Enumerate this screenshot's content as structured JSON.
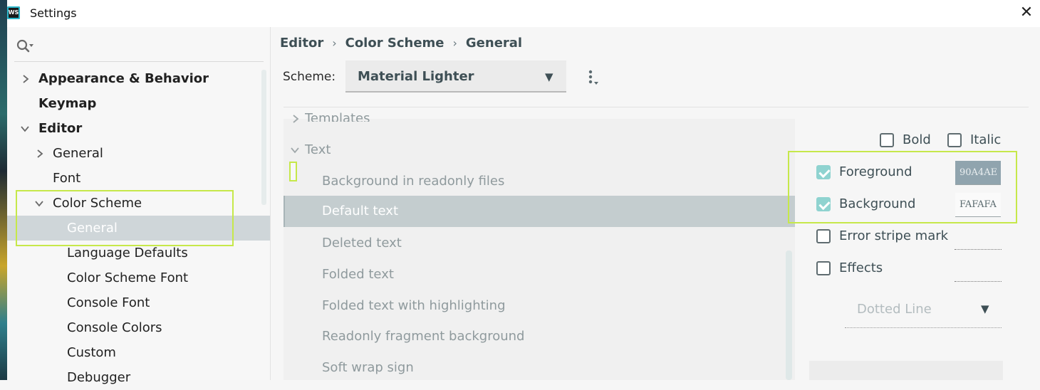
{
  "window": {
    "title": "Settings",
    "app_icon_text": "WS",
    "close_glyph": "✕"
  },
  "sidebar": {
    "search_icon": "search-icon",
    "items": [
      {
        "label": "Appearance & Behavior",
        "expanded": false,
        "bold": true
      },
      {
        "label": "Keymap",
        "bold": true
      },
      {
        "label": "Editor",
        "expanded": true,
        "bold": true
      },
      {
        "label": "General",
        "expanded": false
      },
      {
        "label": "Font"
      },
      {
        "label": "Color Scheme",
        "expanded": true
      },
      {
        "label": "General",
        "selected": true
      },
      {
        "label": "Language Defaults"
      },
      {
        "label": "Color Scheme Font"
      },
      {
        "label": "Console Font"
      },
      {
        "label": "Console Colors"
      },
      {
        "label": "Custom"
      },
      {
        "label": "Debugger"
      }
    ]
  },
  "breadcrumb": [
    "Editor",
    "Color Scheme",
    "General"
  ],
  "breadcrumb_sep": "›",
  "scheme": {
    "label": "Scheme:",
    "value": "Material Lighter",
    "arrow": "▼"
  },
  "element_list": {
    "items": [
      {
        "label": "Templates",
        "kind": "group",
        "expanded": false
      },
      {
        "label": "Text",
        "kind": "group",
        "expanded": true
      },
      {
        "label": "Background in readonly files"
      },
      {
        "label": "Default text",
        "selected": true
      },
      {
        "label": "Deleted text"
      },
      {
        "label": "Folded text"
      },
      {
        "label": "Folded text with highlighting"
      },
      {
        "label": "Readonly fragment background"
      },
      {
        "label": "Soft wrap sign"
      }
    ]
  },
  "attributes": {
    "bold_label": "Bold",
    "bold_checked": false,
    "italic_label": "Italic",
    "italic_checked": false,
    "foreground_label": "Foreground",
    "foreground_checked": true,
    "foreground_hex": "90A4AE",
    "background_label": "Background",
    "background_checked": true,
    "background_hex": "FAFAFA",
    "error_stripe_label": "Error stripe mark",
    "error_stripe_checked": false,
    "effects_label": "Effects",
    "effects_checked": false,
    "effect_type": "Dotted Line",
    "effect_arrow": "▼"
  },
  "colors": {
    "accent_check": "#8fd3d0",
    "highlight_box": "#c6e84a",
    "selected_row": "#cfd6d9",
    "foreground_swatch": "#90A4AE",
    "background_swatch": "#FAFAFA"
  }
}
